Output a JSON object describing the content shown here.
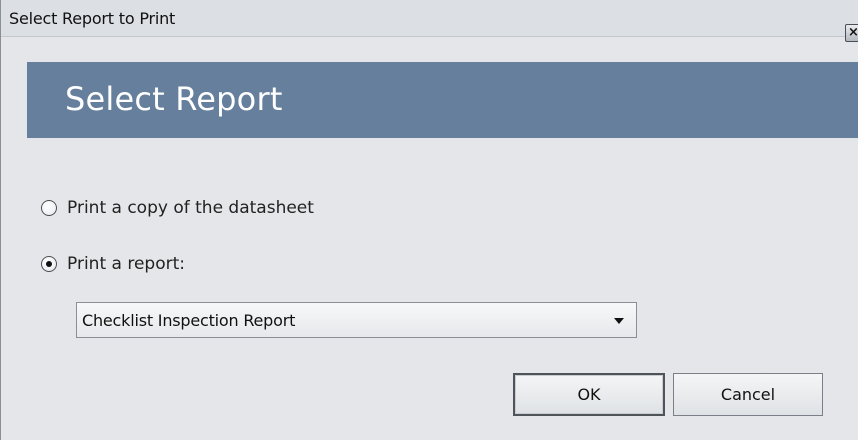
{
  "window": {
    "title": "Select Report to Print",
    "close_icon": "close-icon"
  },
  "header": {
    "title": "Select Report"
  },
  "options": [
    {
      "label": "Print a copy of the datasheet",
      "selected": false
    },
    {
      "label": "Print a report:",
      "selected": true
    }
  ],
  "report_select": {
    "value": "Checklist Inspection Report",
    "icon": "dropdown-arrow-icon"
  },
  "buttons": {
    "ok_label": "OK",
    "cancel_label": "Cancel"
  },
  "colors": {
    "banner": "#657f9c",
    "window_bg": "#e4e6e9"
  }
}
